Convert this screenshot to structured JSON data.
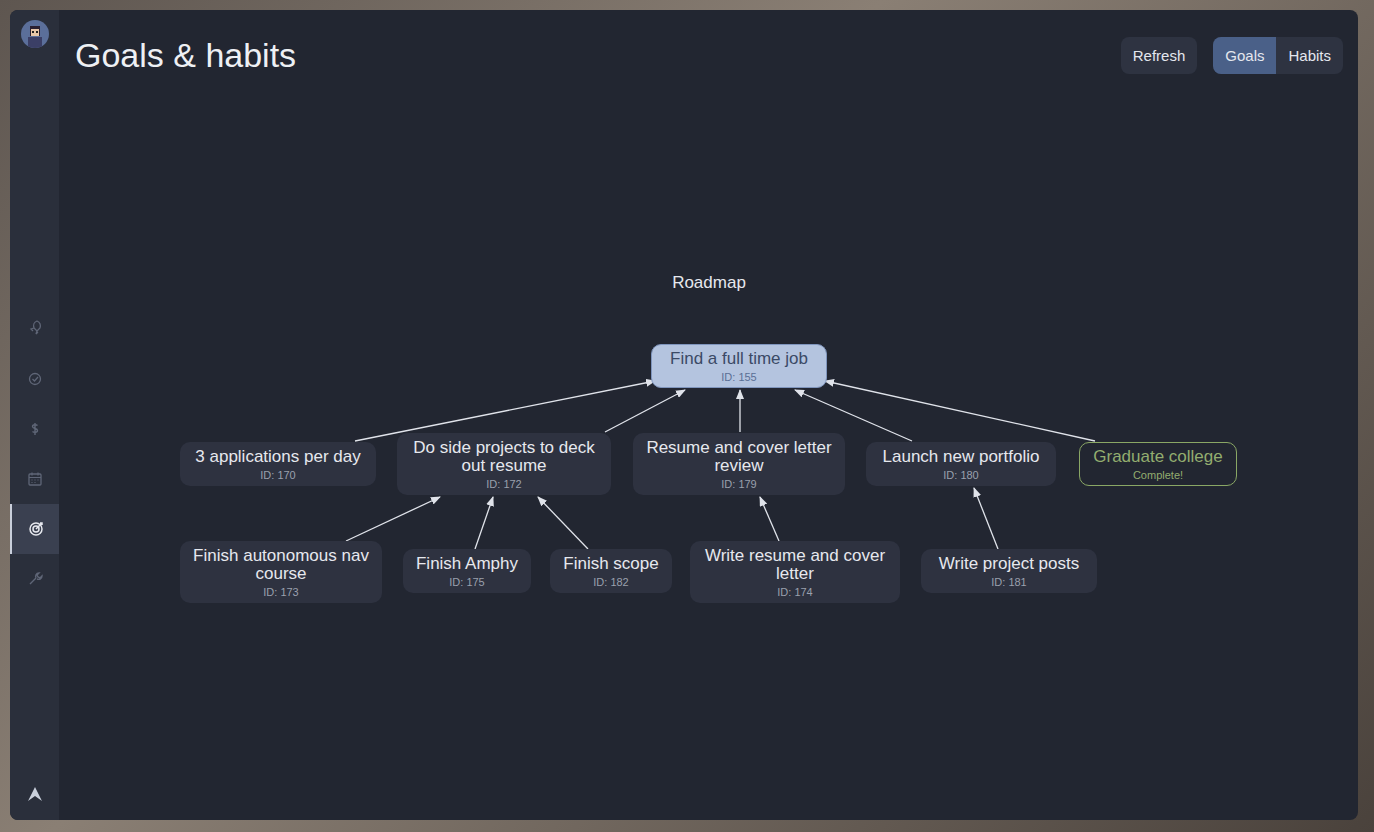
{
  "header": {
    "title": "Goals & habits"
  },
  "buttons": [
    {
      "label": "Refresh"
    }
  ],
  "view_toggle": [
    {
      "label": "Goals",
      "selected": true
    },
    {
      "label": "Habits",
      "selected": false
    }
  ],
  "sidebar": {
    "items": [
      {
        "selected": false
      },
      {
        "selected": false
      },
      {
        "selected": false
      },
      {
        "selected": false
      },
      {
        "selected": true
      },
      {
        "selected": false
      }
    ]
  },
  "roadmap": {
    "title": "Roadmap",
    "root": {
      "title": "Find a full time job",
      "subtitle": "ID: 155",
      "kind": "root",
      "children": [
        {
          "title": "3 applications per day",
          "subtitle": "ID: 170",
          "kind": "goal",
          "children": []
        },
        {
          "title": "Do side projects to deck out resume",
          "subtitle": "ID: 172",
          "kind": "goal",
          "children": [
            {
              "title": "Finish autonomous nav course",
              "subtitle": "ID: 173",
              "kind": "goal",
              "children": []
            },
            {
              "title": "Finish Amphy",
              "subtitle": "ID: 175",
              "kind": "goal",
              "children": []
            },
            {
              "title": "Finish scope",
              "subtitle": "ID: 182",
              "kind": "goal",
              "children": []
            }
          ]
        },
        {
          "title": "Resume and cover letter review",
          "subtitle": "ID: 179",
          "kind": "goal",
          "children": [
            {
              "title": "Write resume and cover letter",
              "subtitle": "ID: 174",
              "kind": "goal",
              "children": []
            }
          ]
        },
        {
          "title": "Launch new portfolio",
          "subtitle": "ID: 180",
          "kind": "goal",
          "children": [
            {
              "title": "Write project posts",
              "subtitle": "ID: 181",
              "kind": "goal",
              "children": []
            }
          ]
        },
        {
          "title": "Graduate college",
          "subtitle": "Complete!",
          "kind": "complete",
          "children": []
        }
      ]
    }
  }
}
